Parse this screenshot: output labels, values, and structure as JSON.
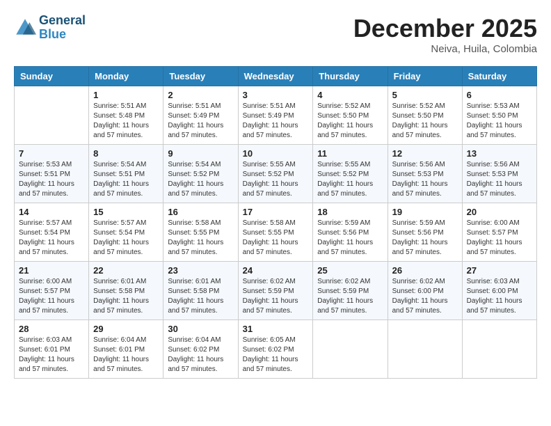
{
  "logo": {
    "line1": "General",
    "line2": "Blue"
  },
  "header": {
    "month": "December 2025",
    "location": "Neiva, Huila, Colombia"
  },
  "days_of_week": [
    "Sunday",
    "Monday",
    "Tuesday",
    "Wednesday",
    "Thursday",
    "Friday",
    "Saturday"
  ],
  "weeks": [
    [
      {
        "day": "",
        "info": ""
      },
      {
        "day": "1",
        "info": "Sunrise: 5:51 AM\nSunset: 5:48 PM\nDaylight: 11 hours\nand 57 minutes."
      },
      {
        "day": "2",
        "info": "Sunrise: 5:51 AM\nSunset: 5:49 PM\nDaylight: 11 hours\nand 57 minutes."
      },
      {
        "day": "3",
        "info": "Sunrise: 5:51 AM\nSunset: 5:49 PM\nDaylight: 11 hours\nand 57 minutes."
      },
      {
        "day": "4",
        "info": "Sunrise: 5:52 AM\nSunset: 5:50 PM\nDaylight: 11 hours\nand 57 minutes."
      },
      {
        "day": "5",
        "info": "Sunrise: 5:52 AM\nSunset: 5:50 PM\nDaylight: 11 hours\nand 57 minutes."
      },
      {
        "day": "6",
        "info": "Sunrise: 5:53 AM\nSunset: 5:50 PM\nDaylight: 11 hours\nand 57 minutes."
      }
    ],
    [
      {
        "day": "7",
        "info": "Sunrise: 5:53 AM\nSunset: 5:51 PM\nDaylight: 11 hours\nand 57 minutes."
      },
      {
        "day": "8",
        "info": "Sunrise: 5:54 AM\nSunset: 5:51 PM\nDaylight: 11 hours\nand 57 minutes."
      },
      {
        "day": "9",
        "info": "Sunrise: 5:54 AM\nSunset: 5:52 PM\nDaylight: 11 hours\nand 57 minutes."
      },
      {
        "day": "10",
        "info": "Sunrise: 5:55 AM\nSunset: 5:52 PM\nDaylight: 11 hours\nand 57 minutes."
      },
      {
        "day": "11",
        "info": "Sunrise: 5:55 AM\nSunset: 5:52 PM\nDaylight: 11 hours\nand 57 minutes."
      },
      {
        "day": "12",
        "info": "Sunrise: 5:56 AM\nSunset: 5:53 PM\nDaylight: 11 hours\nand 57 minutes."
      },
      {
        "day": "13",
        "info": "Sunrise: 5:56 AM\nSunset: 5:53 PM\nDaylight: 11 hours\nand 57 minutes."
      }
    ],
    [
      {
        "day": "14",
        "info": "Sunrise: 5:57 AM\nSunset: 5:54 PM\nDaylight: 11 hours\nand 57 minutes."
      },
      {
        "day": "15",
        "info": "Sunrise: 5:57 AM\nSunset: 5:54 PM\nDaylight: 11 hours\nand 57 minutes."
      },
      {
        "day": "16",
        "info": "Sunrise: 5:58 AM\nSunset: 5:55 PM\nDaylight: 11 hours\nand 57 minutes."
      },
      {
        "day": "17",
        "info": "Sunrise: 5:58 AM\nSunset: 5:55 PM\nDaylight: 11 hours\nand 57 minutes."
      },
      {
        "day": "18",
        "info": "Sunrise: 5:59 AM\nSunset: 5:56 PM\nDaylight: 11 hours\nand 57 minutes."
      },
      {
        "day": "19",
        "info": "Sunrise: 5:59 AM\nSunset: 5:56 PM\nDaylight: 11 hours\nand 57 minutes."
      },
      {
        "day": "20",
        "info": "Sunrise: 6:00 AM\nSunset: 5:57 PM\nDaylight: 11 hours\nand 57 minutes."
      }
    ],
    [
      {
        "day": "21",
        "info": "Sunrise: 6:00 AM\nSunset: 5:57 PM\nDaylight: 11 hours\nand 57 minutes."
      },
      {
        "day": "22",
        "info": "Sunrise: 6:01 AM\nSunset: 5:58 PM\nDaylight: 11 hours\nand 57 minutes."
      },
      {
        "day": "23",
        "info": "Sunrise: 6:01 AM\nSunset: 5:58 PM\nDaylight: 11 hours\nand 57 minutes."
      },
      {
        "day": "24",
        "info": "Sunrise: 6:02 AM\nSunset: 5:59 PM\nDaylight: 11 hours\nand 57 minutes."
      },
      {
        "day": "25",
        "info": "Sunrise: 6:02 AM\nSunset: 5:59 PM\nDaylight: 11 hours\nand 57 minutes."
      },
      {
        "day": "26",
        "info": "Sunrise: 6:02 AM\nSunset: 6:00 PM\nDaylight: 11 hours\nand 57 minutes."
      },
      {
        "day": "27",
        "info": "Sunrise: 6:03 AM\nSunset: 6:00 PM\nDaylight: 11 hours\nand 57 minutes."
      }
    ],
    [
      {
        "day": "28",
        "info": "Sunrise: 6:03 AM\nSunset: 6:01 PM\nDaylight: 11 hours\nand 57 minutes."
      },
      {
        "day": "29",
        "info": "Sunrise: 6:04 AM\nSunset: 6:01 PM\nDaylight: 11 hours\nand 57 minutes."
      },
      {
        "day": "30",
        "info": "Sunrise: 6:04 AM\nSunset: 6:02 PM\nDaylight: 11 hours\nand 57 minutes."
      },
      {
        "day": "31",
        "info": "Sunrise: 6:05 AM\nSunset: 6:02 PM\nDaylight: 11 hours\nand 57 minutes."
      },
      {
        "day": "",
        "info": ""
      },
      {
        "day": "",
        "info": ""
      },
      {
        "day": "",
        "info": ""
      }
    ]
  ]
}
